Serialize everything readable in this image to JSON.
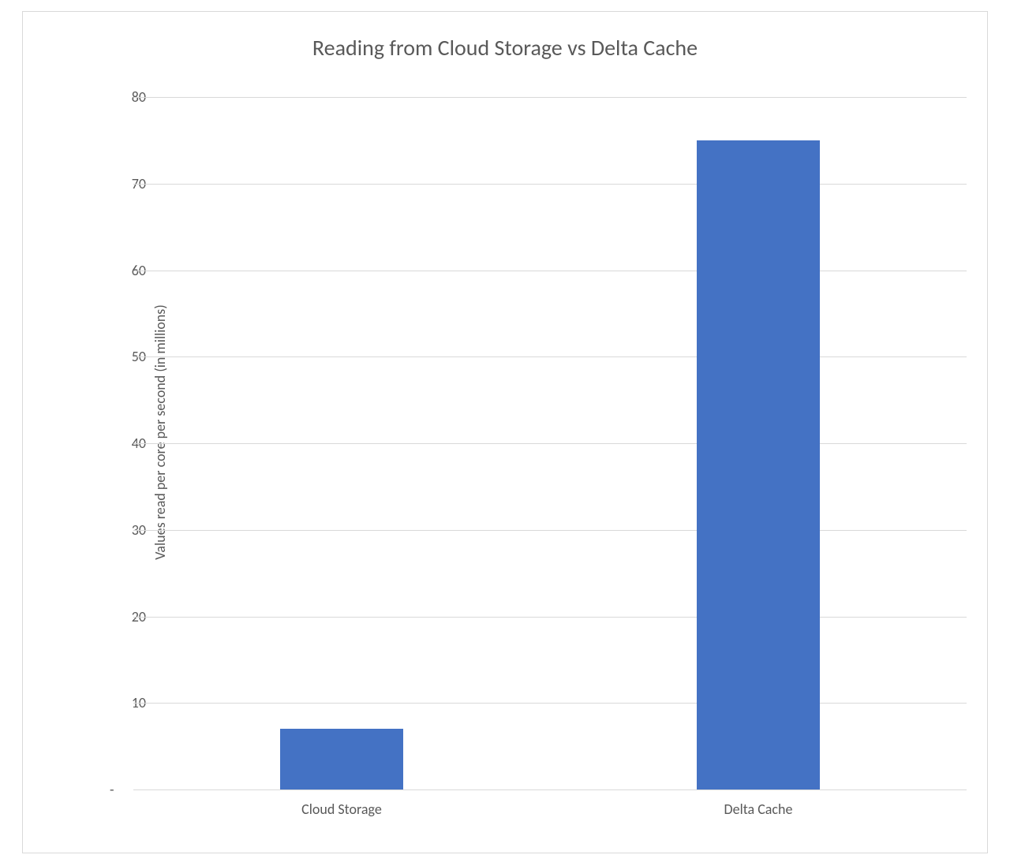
{
  "chart_data": {
    "type": "bar",
    "title": "Reading from Cloud Storage vs Delta Cache",
    "ylabel": "Values read per core per second (in millions)",
    "xlabel": "",
    "categories": [
      "Cloud Storage",
      "Delta Cache"
    ],
    "values": [
      7,
      75
    ],
    "ylim": [
      0,
      80
    ],
    "yticks": [
      0,
      10,
      20,
      30,
      40,
      50,
      60,
      70,
      80
    ],
    "ytick_labels": [
      "-",
      "10",
      "20",
      "30",
      "40",
      "50",
      "60",
      "70",
      "80"
    ],
    "bar_color": "#4472C4",
    "grid": true
  }
}
